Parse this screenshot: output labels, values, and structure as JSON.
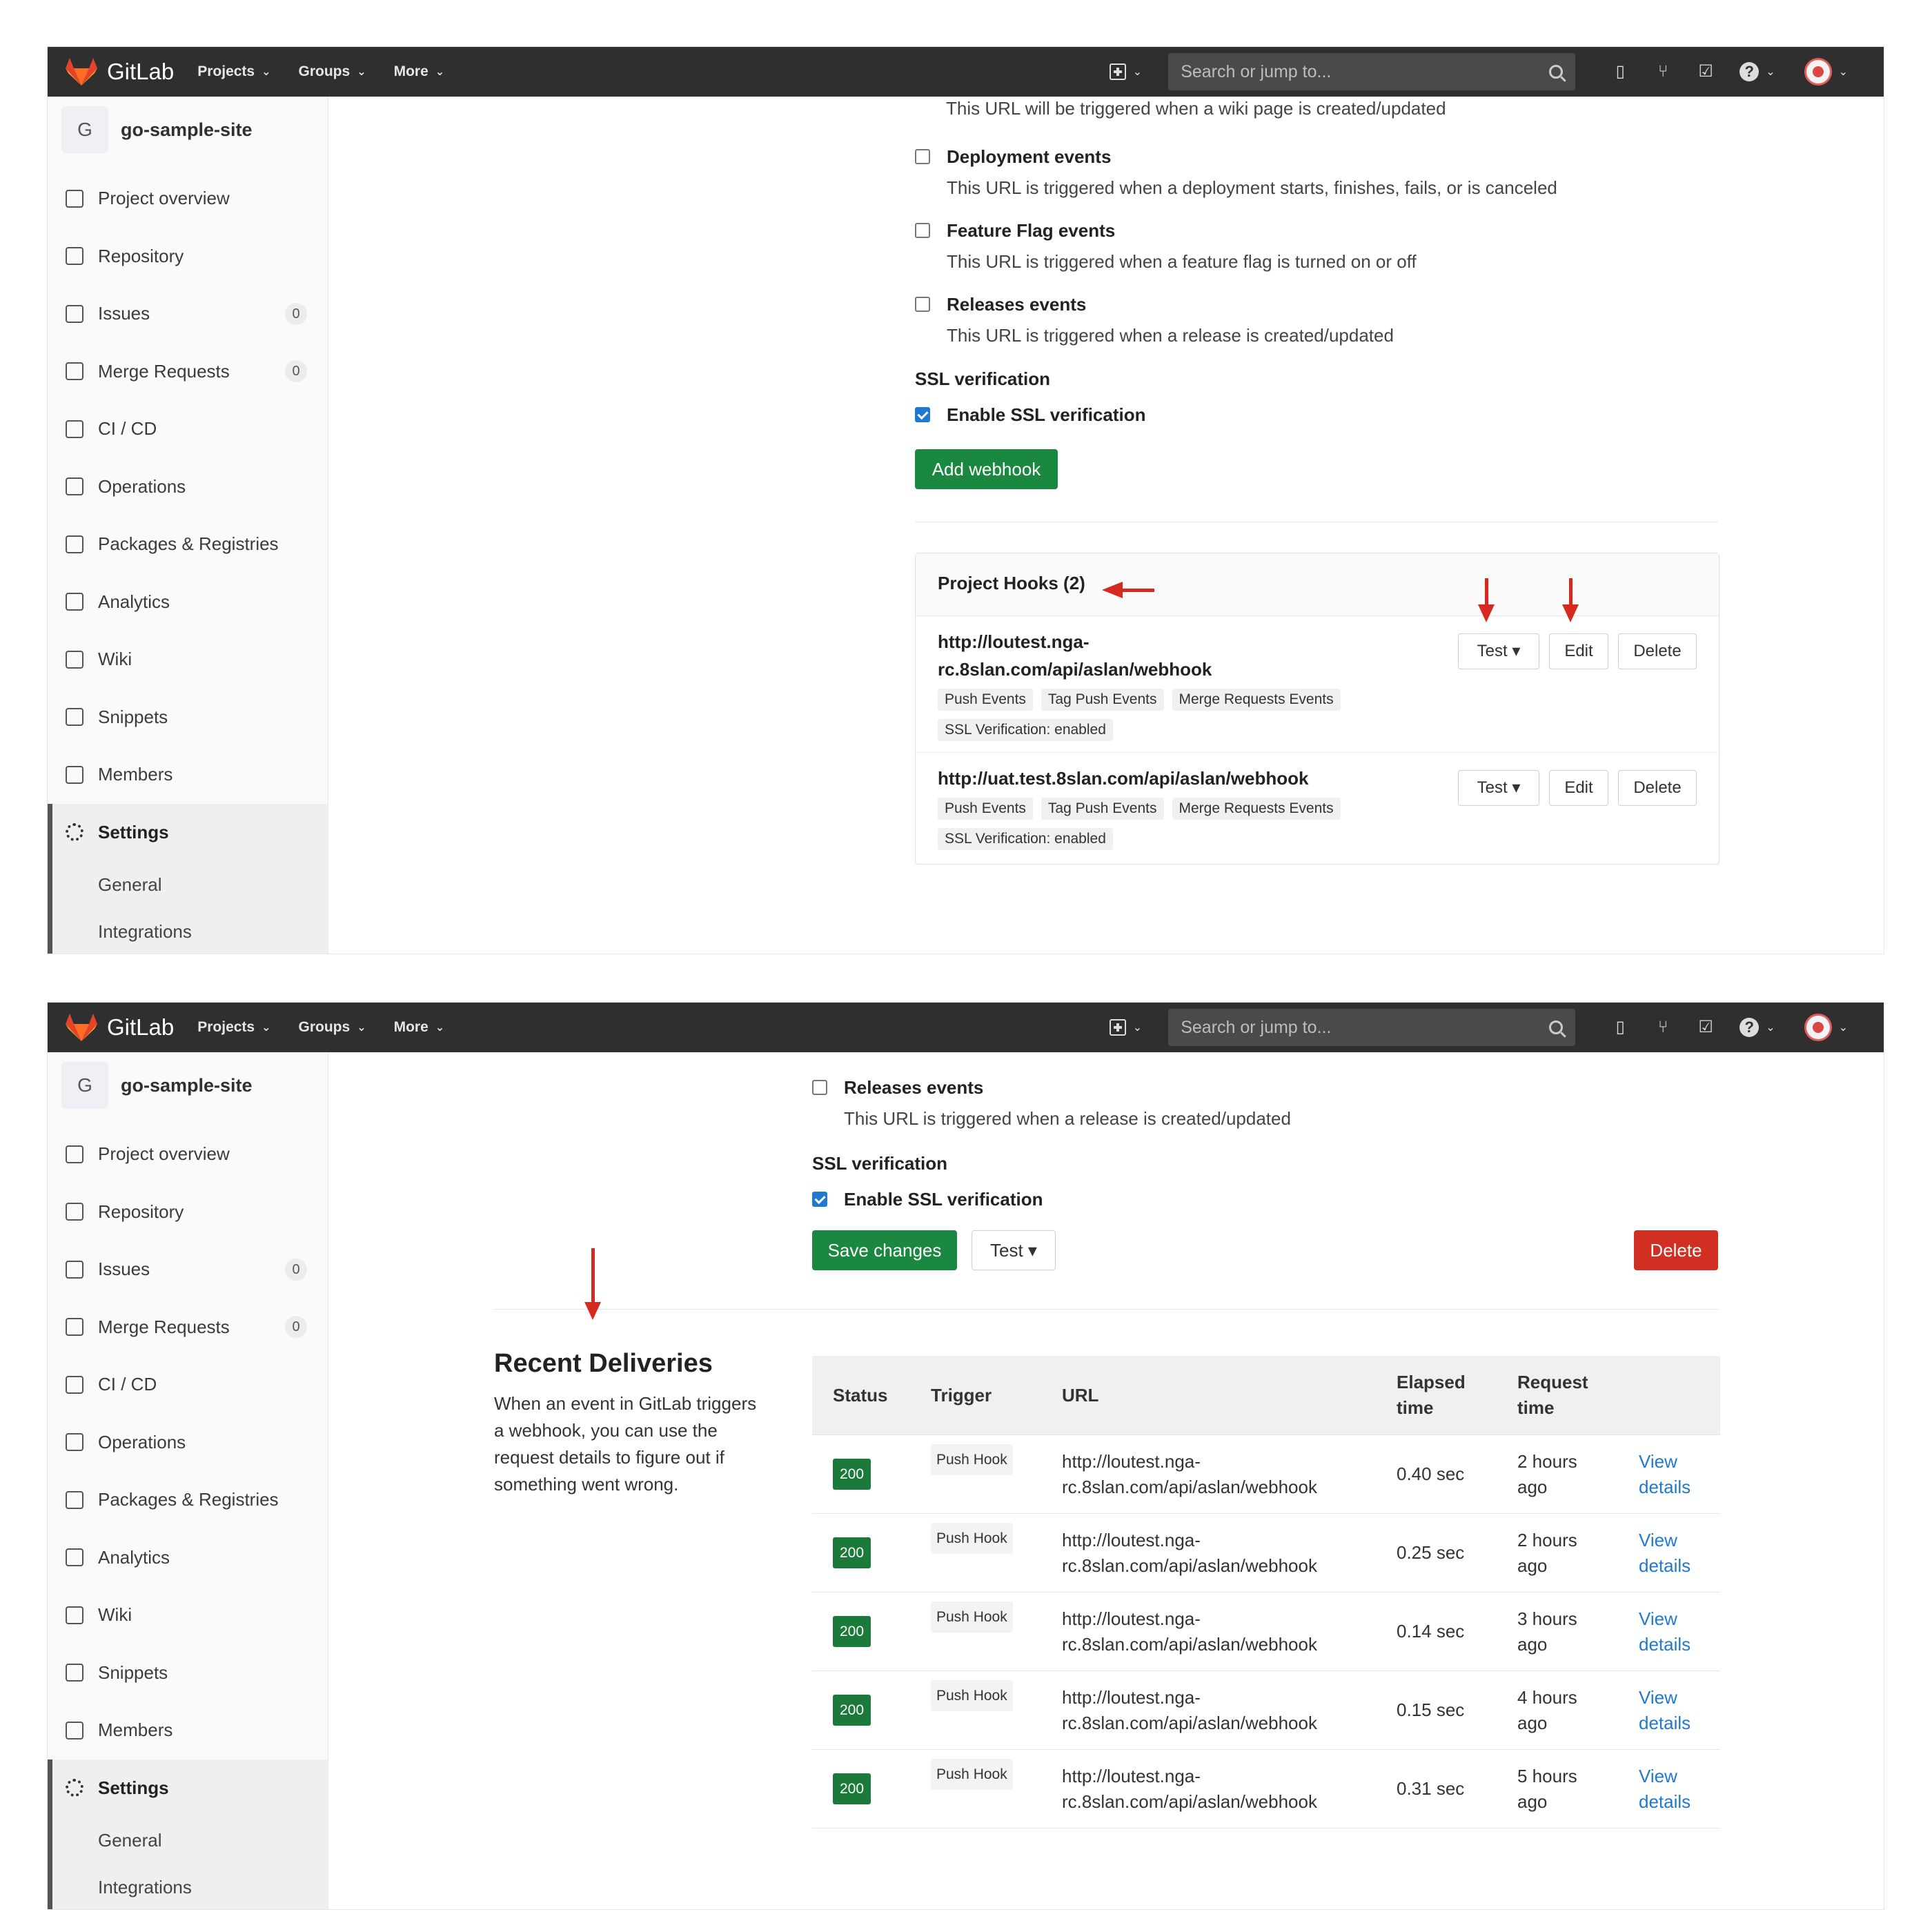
{
  "navbar": {
    "brand": "GitLab",
    "menu": [
      {
        "label": "Projects"
      },
      {
        "label": "Groups"
      },
      {
        "label": "More"
      }
    ],
    "search_placeholder": "Search or jump to..."
  },
  "sidebar": {
    "project_initial": "G",
    "project_name": "go-sample-site",
    "items": [
      {
        "label": "Project overview",
        "icon": "home-icon"
      },
      {
        "label": "Repository",
        "icon": "book-icon"
      },
      {
        "label": "Issues",
        "icon": "issues-icon",
        "badge": "0"
      },
      {
        "label": "Merge Requests",
        "icon": "merge-request-icon",
        "badge": "0"
      },
      {
        "label": "CI / CD",
        "icon": "rocket-icon"
      },
      {
        "label": "Operations",
        "icon": "cloud-icon"
      },
      {
        "label": "Packages & Registries",
        "icon": "package-icon"
      },
      {
        "label": "Analytics",
        "icon": "chart-icon"
      },
      {
        "label": "Wiki",
        "icon": "wiki-icon"
      },
      {
        "label": "Snippets",
        "icon": "scissors-icon"
      },
      {
        "label": "Members",
        "icon": "members-icon"
      },
      {
        "label": "Settings",
        "icon": "gear-icon"
      }
    ],
    "subitems": [
      {
        "label": "General"
      },
      {
        "label": "Integrations"
      }
    ]
  },
  "screen1": {
    "wiki_desc": "This URL will be triggered when a wiki page is created/updated",
    "events": [
      {
        "title": "Deployment events",
        "desc": "This URL is triggered when a deployment starts, finishes, fails, or is canceled"
      },
      {
        "title": "Feature Flag events",
        "desc": "This URL is triggered when a feature flag is turned on or off"
      },
      {
        "title": "Releases events",
        "desc": "This URL is triggered when a release is created/updated"
      }
    ],
    "ssl_label": "SSL verification",
    "ssl_checkbox": "Enable SSL verification",
    "add_webhook": "Add webhook",
    "hooks_title": "Project Hooks (2)",
    "hooks": [
      {
        "url_line1": "http://loutest.nga-",
        "url_line2": "rc.8slan.com/api/aslan/webhook",
        "tags": [
          "Push Events",
          "Tag Push Events",
          "Merge Requests Events"
        ],
        "ssl": "SSL Verification: enabled"
      },
      {
        "url_line1": "http://uat.test.8slan.com/api/aslan/webhook",
        "tags": [
          "Push Events",
          "Tag Push Events",
          "Merge Requests Events"
        ],
        "ssl": "SSL Verification: enabled"
      }
    ],
    "btn_test": "Test",
    "btn_edit": "Edit",
    "btn_delete": "Delete"
  },
  "screen2": {
    "release_title": "Releases events",
    "release_desc": "This URL is triggered when a release is created/updated",
    "ssl_label": "SSL verification",
    "ssl_checkbox": "Enable SSL verification",
    "save_changes": "Save changes",
    "test": "Test",
    "delete": "Delete",
    "recent_title": "Recent Deliveries",
    "recent_text": "When an event in GitLab triggers a webhook, you can use the request details to figure out if something went wrong.",
    "table": {
      "headers": [
        "Status",
        "Trigger",
        "URL",
        "Elapsed time",
        "Request time",
        ""
      ],
      "rows": [
        {
          "status": "200",
          "trigger": "Push Hook",
          "url1": "http://loutest.nga-",
          "url2": "rc.8slan.com/api/aslan/webhook",
          "elapsed": "0.40 sec",
          "req1": "2 hours",
          "req2": "ago",
          "link1": "View",
          "link2": "details"
        },
        {
          "status": "200",
          "trigger": "Push Hook",
          "url1": "http://loutest.nga-",
          "url2": "rc.8slan.com/api/aslan/webhook",
          "elapsed": "0.25 sec",
          "req1": "2 hours",
          "req2": "ago",
          "link1": "View",
          "link2": "details"
        },
        {
          "status": "200",
          "trigger": "Push Hook",
          "url1": "http://loutest.nga-",
          "url2": "rc.8slan.com/api/aslan/webhook",
          "elapsed": "0.14 sec",
          "req1": "3 hours",
          "req2": "ago",
          "link1": "View",
          "link2": "details"
        },
        {
          "status": "200",
          "trigger": "Push Hook",
          "url1": "http://loutest.nga-",
          "url2": "rc.8slan.com/api/aslan/webhook",
          "elapsed": "0.15 sec",
          "req1": "4 hours",
          "req2": "ago",
          "link1": "View",
          "link2": "details"
        },
        {
          "status": "200",
          "trigger": "Push Hook",
          "url1": "http://loutest.nga-",
          "url2": "rc.8slan.com/api/aslan/webhook",
          "elapsed": "0.31 sec",
          "req1": "5 hours",
          "req2": "ago",
          "link1": "View",
          "link2": "details"
        }
      ]
    }
  },
  "colors": {
    "navbar": "#2f2f2f",
    "success_green": "#1b8841",
    "danger_red": "#d22f23",
    "annotation_arrow": "#d62a1e",
    "link_blue": "#1f78d1"
  }
}
